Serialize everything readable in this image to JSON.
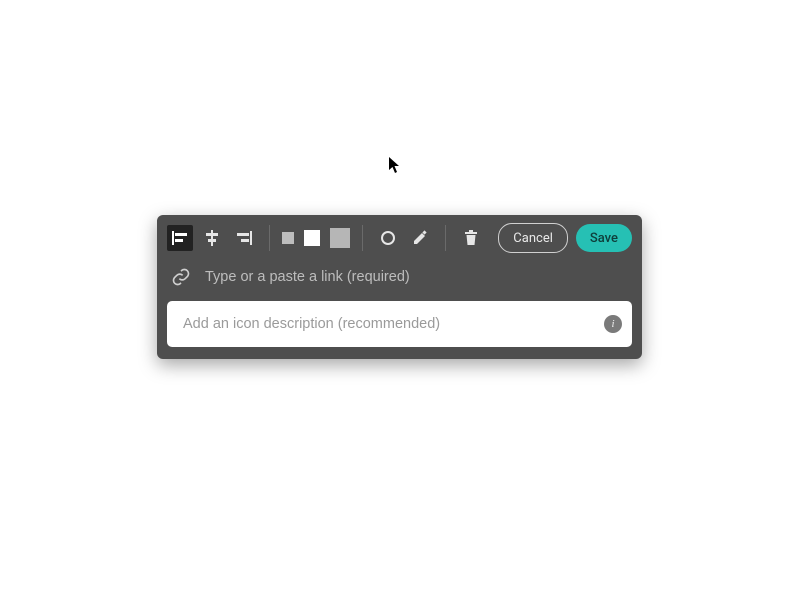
{
  "toolbar": {
    "align_left": "align-left-icon",
    "align_center": "align-center-icon",
    "align_right": "align-right-icon",
    "size_small": "size-small-swatch",
    "size_medium": "size-medium-swatch",
    "size_large": "size-large-swatch",
    "shape_circle": "circle-icon",
    "shape_edit": "pencil-icon",
    "delete": "trash-icon"
  },
  "actions": {
    "cancel_label": "Cancel",
    "save_label": "Save"
  },
  "link": {
    "placeholder": "Type or a paste a link (required)",
    "value": ""
  },
  "description": {
    "placeholder": "Add an icon description (recommended)",
    "value": "",
    "info_glyph": "i"
  },
  "colors": {
    "panel_bg": "#4e4e4e",
    "accent": "#26c0b4"
  }
}
